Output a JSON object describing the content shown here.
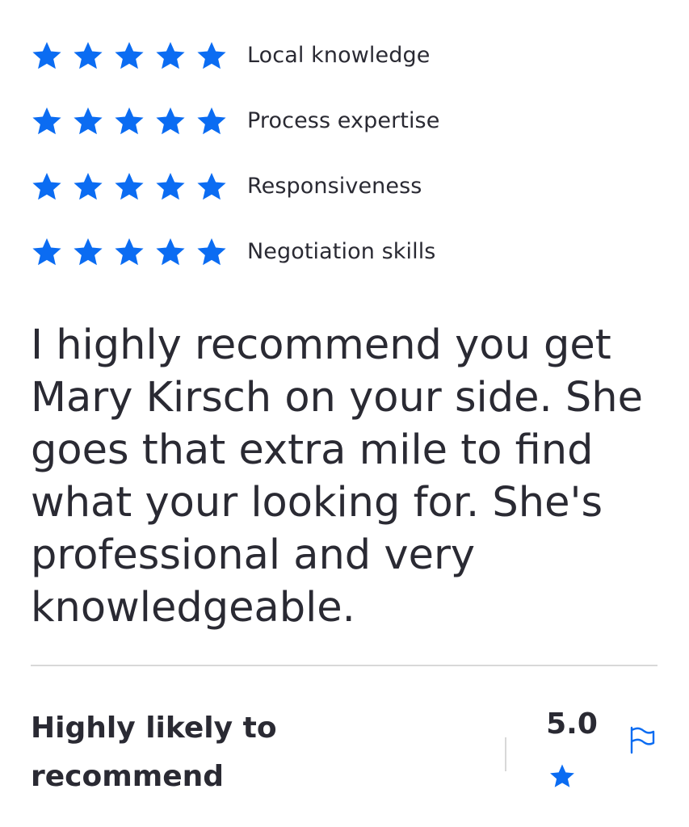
{
  "colors": {
    "star": "#0b6cf2",
    "text": "#2a2a33",
    "divider": "#d8d8d8"
  },
  "ratings": [
    {
      "label": "Local knowledge",
      "stars": 5
    },
    {
      "label": "Process expertise",
      "stars": 5
    },
    {
      "label": "Responsiveness",
      "stars": 5
    },
    {
      "label": "Negotiation skills",
      "stars": 5
    }
  ],
  "review": {
    "text": "I highly recommend you get Mary Kirsch on your side. She goes that extra mile to find what your looking for. She's professional and very knowledgeable."
  },
  "summary": {
    "recommend_line1": "Highly likely to",
    "recommend_line2": "recommend",
    "score": "5.0",
    "score_icon": "star-icon",
    "report_icon": "flag-icon"
  }
}
